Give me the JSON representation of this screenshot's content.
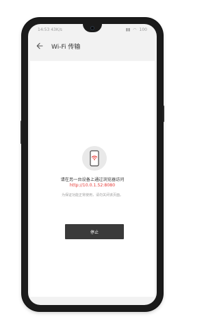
{
  "status_bar": {
    "left_text": "14:53 43K/s",
    "right_text": "100"
  },
  "app_bar": {
    "back_icon": "arrow-left-icon",
    "title": "Wi-Fi 传输"
  },
  "transfer": {
    "illustration_icon": "phone-wifi-icon",
    "message": "请在另一台设备上通过浏览器访问",
    "url": "http://10.0.1.52:8080",
    "hint": "为保证功能正常使用，请勿关闭该页面。",
    "stop_label": "停止"
  },
  "colors": {
    "url": "#e53935",
    "button_bg": "#3a3a3a",
    "screen_bg": "#f2f2f2"
  }
}
